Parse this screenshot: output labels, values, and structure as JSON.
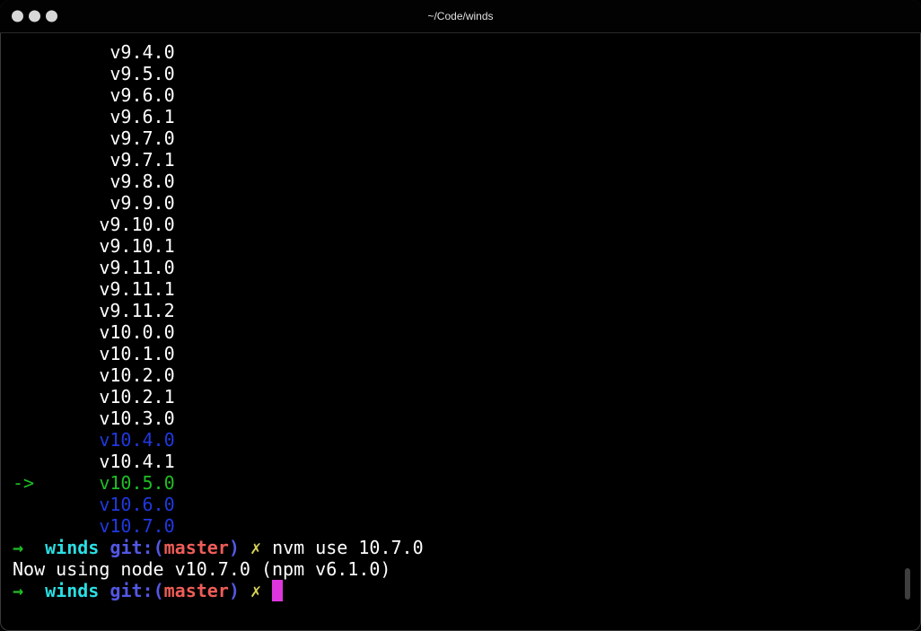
{
  "window": {
    "title": "~/Code/winds",
    "traffic_lights": [
      {
        "name": "close-button"
      },
      {
        "name": "minimize-button"
      },
      {
        "name": "zoom-button"
      }
    ]
  },
  "palette": {
    "background": "#000000",
    "white": "#ffffff",
    "blue": "#2038e0",
    "blue_bright": "#5357e3",
    "green": "#1fbe25",
    "cyan": "#2adfe4",
    "red": "#ef5d58",
    "yellow": "#d6d255",
    "magenta_cursor": "#dd36dd",
    "title_fg": "#e0e0e0",
    "traffic_light": "#d8d8d8",
    "scrollbar_thumb": "#3f3f3f"
  },
  "terminal": {
    "lines": [
      {
        "name": "version-line",
        "segments": [
          {
            "text": "         v9.4.0",
            "color": "white"
          }
        ]
      },
      {
        "name": "version-line",
        "segments": [
          {
            "text": "         v9.5.0",
            "color": "white"
          }
        ]
      },
      {
        "name": "version-line",
        "segments": [
          {
            "text": "         v9.6.0",
            "color": "white"
          }
        ]
      },
      {
        "name": "version-line",
        "segments": [
          {
            "text": "         v9.6.1",
            "color": "white"
          }
        ]
      },
      {
        "name": "version-line",
        "segments": [
          {
            "text": "         v9.7.0",
            "color": "white"
          }
        ]
      },
      {
        "name": "version-line",
        "segments": [
          {
            "text": "         v9.7.1",
            "color": "white"
          }
        ]
      },
      {
        "name": "version-line",
        "segments": [
          {
            "text": "         v9.8.0",
            "color": "white"
          }
        ]
      },
      {
        "name": "version-line",
        "segments": [
          {
            "text": "         v9.9.0",
            "color": "white"
          }
        ]
      },
      {
        "name": "version-line",
        "segments": [
          {
            "text": "        v9.10.0",
            "color": "white"
          }
        ]
      },
      {
        "name": "version-line",
        "segments": [
          {
            "text": "        v9.10.1",
            "color": "white"
          }
        ]
      },
      {
        "name": "version-line",
        "segments": [
          {
            "text": "        v9.11.0",
            "color": "white"
          }
        ]
      },
      {
        "name": "version-line",
        "segments": [
          {
            "text": "        v9.11.1",
            "color": "white"
          }
        ]
      },
      {
        "name": "version-line",
        "segments": [
          {
            "text": "        v9.11.2",
            "color": "white"
          }
        ]
      },
      {
        "name": "version-line",
        "segments": [
          {
            "text": "        v10.0.0",
            "color": "white"
          }
        ]
      },
      {
        "name": "version-line",
        "segments": [
          {
            "text": "        v10.1.0",
            "color": "white"
          }
        ]
      },
      {
        "name": "version-line",
        "segments": [
          {
            "text": "        v10.2.0",
            "color": "white"
          }
        ]
      },
      {
        "name": "version-line",
        "segments": [
          {
            "text": "        v10.2.1",
            "color": "white"
          }
        ]
      },
      {
        "name": "version-line",
        "segments": [
          {
            "text": "        v10.3.0",
            "color": "white"
          }
        ]
      },
      {
        "name": "version-line",
        "segments": [
          {
            "text": "        v10.4.0",
            "color": "blue"
          }
        ]
      },
      {
        "name": "version-line",
        "segments": [
          {
            "text": "        v10.4.1",
            "color": "white"
          }
        ]
      },
      {
        "name": "current-version-line",
        "segments": [
          {
            "text": "->      v10.5.0",
            "color": "green"
          }
        ]
      },
      {
        "name": "version-line",
        "segments": [
          {
            "text": "        v10.6.0",
            "color": "blue"
          }
        ]
      },
      {
        "name": "version-line",
        "segments": [
          {
            "text": "        v10.7.0",
            "color": "blue"
          }
        ]
      },
      {
        "name": "prompt-line",
        "segments": [
          {
            "text": "→",
            "color": "green",
            "bold": true
          },
          {
            "text": "  ",
            "color": "white"
          },
          {
            "text": "winds",
            "color": "cyan",
            "bold": true
          },
          {
            "text": " ",
            "color": "white"
          },
          {
            "text": "git:(",
            "color": "blue_bright",
            "bold": true
          },
          {
            "text": "master",
            "color": "red",
            "bold": true
          },
          {
            "text": ") ",
            "color": "blue_bright",
            "bold": true
          },
          {
            "text": "✗ ",
            "color": "yellow"
          },
          {
            "text": "nvm use 10.7.0",
            "color": "white"
          }
        ]
      },
      {
        "name": "output-line",
        "segments": [
          {
            "text": "Now using node v10.7.0 (npm v6.1.0)",
            "color": "white"
          }
        ]
      },
      {
        "name": "prompt-line",
        "segments": [
          {
            "text": "→",
            "color": "green",
            "bold": true
          },
          {
            "text": "  ",
            "color": "white"
          },
          {
            "text": "winds",
            "color": "cyan",
            "bold": true
          },
          {
            "text": " ",
            "color": "white"
          },
          {
            "text": "git:(",
            "color": "blue_bright",
            "bold": true
          },
          {
            "text": "master",
            "color": "red",
            "bold": true
          },
          {
            "text": ") ",
            "color": "blue_bright",
            "bold": true
          },
          {
            "text": "✗ ",
            "color": "yellow"
          },
          {
            "text": " ",
            "cursor": true
          }
        ]
      }
    ]
  }
}
